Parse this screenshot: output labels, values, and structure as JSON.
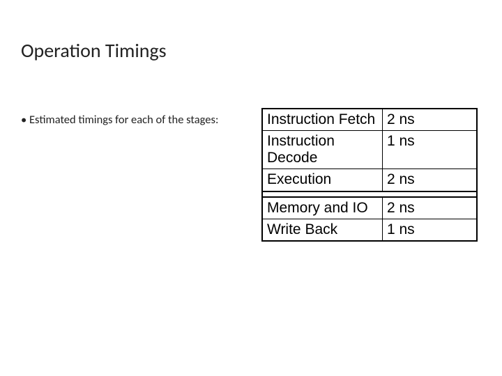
{
  "title": "Operation Timings",
  "bullet_text": "Estimated timings for each of the stages:",
  "timing_table": {
    "group1": [
      {
        "stage": "Instruction Fetch",
        "time": "2 ns"
      },
      {
        "stage": "Instruction Decode",
        "time": "1 ns"
      },
      {
        "stage": "Execution",
        "time": "2 ns"
      }
    ],
    "group2": [
      {
        "stage": "Memory and IO",
        "time": "2 ns"
      },
      {
        "stage": "Write Back",
        "time": "1 ns"
      }
    ]
  }
}
